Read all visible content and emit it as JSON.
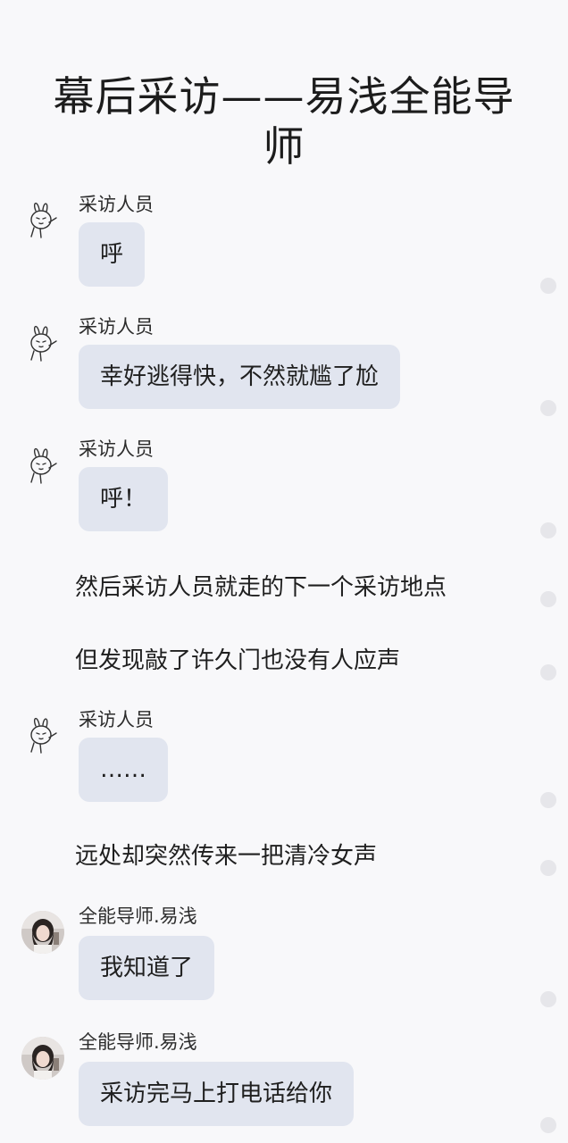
{
  "title": "幕后采访——易浅全能导师",
  "speakers": {
    "interviewer": "采访人员",
    "mentor": "全能导师.易浅"
  },
  "avatars": {
    "interviewer": "rabbit-sticker-avatar",
    "mentor": "girl-photo-avatar"
  },
  "messages": [
    {
      "speaker": "采访人员",
      "text": "呼"
    },
    {
      "speaker": "采访人员",
      "text": "幸好逃得快，不然就尴了尬"
    },
    {
      "speaker": "采访人员",
      "text": "呼！"
    },
    {
      "narration": "然后采访人员就走的下一个采访地点"
    },
    {
      "narration": "但发现敲了许久门也没有人应声"
    },
    {
      "speaker": "采访人员",
      "text": "……"
    },
    {
      "narration": "远处却突然传来一把清冷女声"
    },
    {
      "speaker": "全能导师.易浅",
      "text": "我知道了"
    },
    {
      "speaker": "全能导师.易浅",
      "text": "采访完马上打电话给你"
    }
  ],
  "colors": {
    "background": "#f8f8fa",
    "bubble": "#e1e5ef",
    "dot": "#e6e6ea"
  }
}
